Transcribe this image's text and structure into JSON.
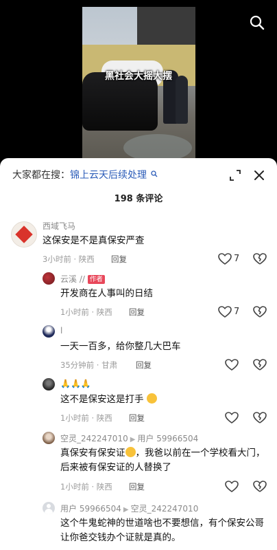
{
  "video": {
    "overlay_text": "黑社会大摇大摆"
  },
  "sheet": {
    "search_label": "大家都在搜：",
    "search_query": "锦上云天后续处理",
    "count": "198 条评论"
  },
  "comments": [
    {
      "user": "西域飞马",
      "text": "这保安是不是真保安严查",
      "time": "3小时前 · 陕西",
      "reply": "回复",
      "likes": "7"
    },
    {
      "user": "云溪 //",
      "tag": "作者",
      "text": "开发商在人事叫的日结",
      "time": "1小时前 · 陕西",
      "reply": "回复",
      "likes": "7"
    },
    {
      "user": "l",
      "text": "一天一百多，给你整几大巴车",
      "time": "35分钟前 · 甘肃",
      "reply": "回复"
    },
    {
      "user": "🙏🙏🙏",
      "text": "这不是保安这是打手",
      "time": "1小时前 · 陕西",
      "reply": "回复"
    },
    {
      "user": "空灵_242247010",
      "reply_to": "用户 59966504",
      "text_part1": "真保安有保安证",
      "text_part2": "，我爸以前在一个学校看大门，后来被有保安证的人替换了",
      "time": "1小时前 · 陕西",
      "reply": "回复"
    },
    {
      "user": "用户 59966504",
      "reply_to": "空灵_242247010",
      "text": "这个牛鬼蛇神的世道啥也不要想信，有个保安公哥让你爸交钱办个证就是真的。"
    }
  ],
  "colors": {
    "link": "#2a5bb8",
    "author_tag": "#e8475a"
  }
}
